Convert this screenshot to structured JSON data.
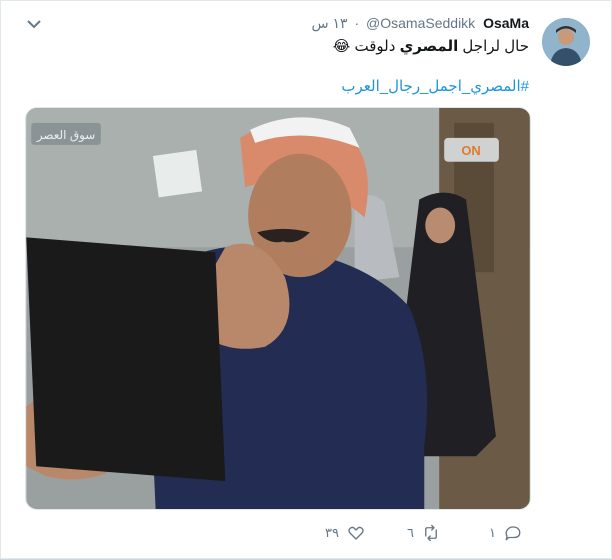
{
  "tweet": {
    "display_name": "OsaMa",
    "handle": "@OsamaSeddikk",
    "separator": "·",
    "time": "١٣ س",
    "text_before": "حال لراجل ",
    "text_bold": "المصري",
    "text_after": " دلوقت 😂",
    "hashtag": "#المصري_اجمل_رجال_العرب"
  },
  "media": {
    "watermark_left": "سوق العصر",
    "watermark_right": "ON"
  },
  "actions": {
    "reply_count": "١",
    "retweet_count": "٦",
    "like_count": "٣٩"
  },
  "icons": {
    "menu": "chevron-down-icon",
    "reply": "reply-icon",
    "retweet": "retweet-icon",
    "like": "heart-icon"
  },
  "colors": {
    "link": "#1b95e0",
    "muted": "#657786"
  }
}
